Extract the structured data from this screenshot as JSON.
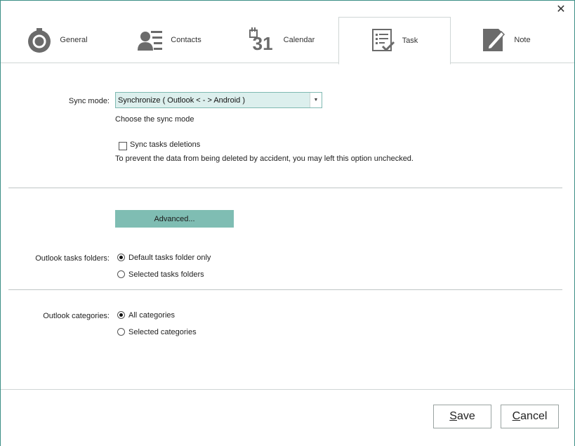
{
  "window": {
    "close_label": "✕"
  },
  "tabs": [
    {
      "label": "General",
      "icon": "gear-icon"
    },
    {
      "label": "Contacts",
      "icon": "contacts-icon"
    },
    {
      "label": "Calendar",
      "icon": "calendar-icon",
      "day": "31"
    },
    {
      "label": "Task",
      "icon": "task-icon",
      "active": true
    },
    {
      "label": "Note",
      "icon": "note-icon"
    }
  ],
  "sync": {
    "label": "Sync mode:",
    "value": "Synchronize  ( Outlook < - > Android )",
    "hint": "Choose the sync mode",
    "deletions_label": "Sync tasks deletions",
    "deletions_checked": false,
    "deletions_hint": "To prevent the data from being deleted by accident, you may left this option unchecked."
  },
  "advanced": {
    "label": "Advanced..."
  },
  "folders": {
    "label": "Outlook tasks folders:",
    "options": [
      "Default tasks folder only",
      "Selected tasks folders"
    ],
    "selected": 0
  },
  "categories": {
    "label": "Outlook categories:",
    "options": [
      "All categories",
      "Selected categories"
    ],
    "selected": 0
  },
  "footer": {
    "save_first": "S",
    "save_rest": "ave",
    "cancel_first": "C",
    "cancel_rest": "ancel"
  },
  "colors": {
    "accent": "#7fbdb3",
    "combo_bg": "#dcefed",
    "border": "#3c8f86"
  }
}
